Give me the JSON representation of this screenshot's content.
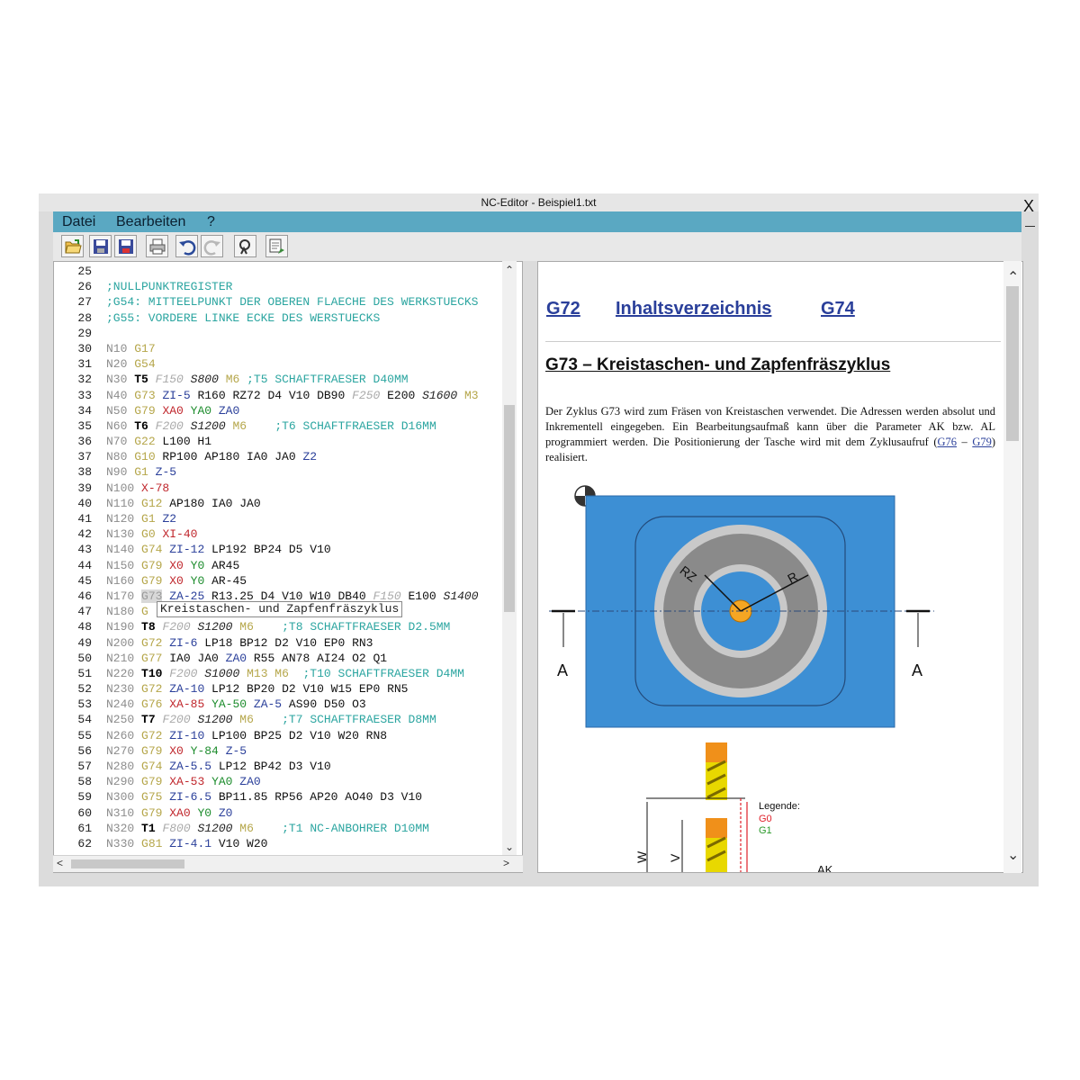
{
  "window": {
    "title": "NC-Editor  -  Beispiel1.txt",
    "close_glyph": "X"
  },
  "menu": {
    "items": [
      {
        "label": "Datei"
      },
      {
        "label": "Bearbeiten"
      },
      {
        "label": "?"
      }
    ]
  },
  "toolbar": {
    "buttons": [
      "open-icon",
      "save-icon",
      "save-as-icon",
      "print-icon",
      "undo-icon",
      "redo-icon",
      "search-icon",
      "simulation-icon"
    ]
  },
  "editor": {
    "lines": [
      {
        "n": "25",
        "t": []
      },
      {
        "n": "26",
        "t": [
          [
            ";NULLPUNKTREGISTER",
            "c"
          ]
        ]
      },
      {
        "n": "27",
        "t": [
          [
            ";G54: MITTEELPUNKT DER OBEREN FLAECHE DES WERKSTUECKS",
            "c"
          ]
        ]
      },
      {
        "n": "28",
        "t": [
          [
            ";G55: VORDERE LINKE ECKE DES WERSTUECKS",
            "c"
          ]
        ]
      },
      {
        "n": "29",
        "t": []
      },
      {
        "n": "30",
        "t": [
          [
            "N10 ",
            "n"
          ],
          [
            "G17",
            "g"
          ]
        ]
      },
      {
        "n": "31",
        "t": [
          [
            "N20 ",
            "n"
          ],
          [
            "G54",
            "g"
          ]
        ]
      },
      {
        "n": "32",
        "t": [
          [
            "N30 ",
            "n"
          ],
          [
            "T5",
            "t"
          ],
          [
            " ",
            "p"
          ],
          [
            "F150",
            "f"
          ],
          [
            " ",
            "p"
          ],
          [
            "S800",
            "s"
          ],
          [
            " ",
            "p"
          ],
          [
            "M6",
            "g"
          ],
          [
            " ;T5 SCHAFTFRAESER D40MM",
            "c"
          ]
        ]
      },
      {
        "n": "33",
        "t": [
          [
            "N40 ",
            "n"
          ],
          [
            "G73",
            "g"
          ],
          [
            " ",
            "p"
          ],
          [
            "ZI-5",
            "z"
          ],
          [
            " R160 RZ72 D4 V10 DB90 ",
            "p"
          ],
          [
            "F250",
            "f"
          ],
          [
            " E200 ",
            "p"
          ],
          [
            "S1600",
            "s"
          ],
          [
            " M3",
            "g"
          ]
        ]
      },
      {
        "n": "34",
        "t": [
          [
            "N50 ",
            "n"
          ],
          [
            "G79",
            "g"
          ],
          [
            " ",
            "p"
          ],
          [
            "XA0",
            "x"
          ],
          [
            " ",
            "p"
          ],
          [
            "YA0",
            "y"
          ],
          [
            " ",
            "p"
          ],
          [
            "ZA0",
            "z"
          ]
        ]
      },
      {
        "n": "35",
        "t": [
          [
            "N60 ",
            "n"
          ],
          [
            "T6",
            "t"
          ],
          [
            " ",
            "p"
          ],
          [
            "F200",
            "f"
          ],
          [
            " ",
            "p"
          ],
          [
            "S1200",
            "s"
          ],
          [
            " ",
            "p"
          ],
          [
            "M6",
            "g"
          ],
          [
            "    ;T6 SCHAFTFRAESER D16MM",
            "c"
          ]
        ]
      },
      {
        "n": "36",
        "t": [
          [
            "N70 ",
            "n"
          ],
          [
            "G22",
            "g"
          ],
          [
            " L100 H1",
            "p"
          ]
        ]
      },
      {
        "n": "37",
        "t": [
          [
            "N80 ",
            "n"
          ],
          [
            "G10",
            "g"
          ],
          [
            " RP100 AP180 IA0 JA0 ",
            "p"
          ],
          [
            "Z2",
            "z"
          ]
        ]
      },
      {
        "n": "38",
        "t": [
          [
            "N90 ",
            "n"
          ],
          [
            "G1",
            "g"
          ],
          [
            " ",
            "p"
          ],
          [
            "Z-5",
            "z"
          ]
        ]
      },
      {
        "n": "39",
        "t": [
          [
            "N100 ",
            "n"
          ],
          [
            "X-78",
            "x"
          ]
        ]
      },
      {
        "n": "40",
        "t": [
          [
            "N110 ",
            "n"
          ],
          [
            "G12",
            "g"
          ],
          [
            " AP180 IA0 JA0",
            "p"
          ]
        ]
      },
      {
        "n": "41",
        "t": [
          [
            "N120 ",
            "n"
          ],
          [
            "G1",
            "g"
          ],
          [
            " ",
            "p"
          ],
          [
            "Z2",
            "z"
          ]
        ]
      },
      {
        "n": "42",
        "t": [
          [
            "N130 ",
            "n"
          ],
          [
            "G0",
            "g"
          ],
          [
            " ",
            "p"
          ],
          [
            "XI-40",
            "x"
          ]
        ]
      },
      {
        "n": "43",
        "t": [
          [
            "N140 ",
            "n"
          ],
          [
            "G74",
            "g"
          ],
          [
            " ",
            "p"
          ],
          [
            "ZI-12",
            "z"
          ],
          [
            " LP192 BP24 D5 V10",
            "p"
          ]
        ]
      },
      {
        "n": "44",
        "t": [
          [
            "N150 ",
            "n"
          ],
          [
            "G79",
            "g"
          ],
          [
            " ",
            "p"
          ],
          [
            "X0",
            "x"
          ],
          [
            " ",
            "p"
          ],
          [
            "Y0",
            "y"
          ],
          [
            " AR45",
            "p"
          ]
        ]
      },
      {
        "n": "45",
        "t": [
          [
            "N160 ",
            "n"
          ],
          [
            "G79",
            "g"
          ],
          [
            " ",
            "p"
          ],
          [
            "X0",
            "x"
          ],
          [
            " ",
            "p"
          ],
          [
            "Y0",
            "y"
          ],
          [
            " AR-45",
            "p"
          ]
        ]
      },
      {
        "n": "46",
        "t": [
          [
            "N170 ",
            "n"
          ],
          [
            "G73",
            "sel"
          ],
          [
            " ",
            "p"
          ],
          [
            "ZA-25",
            "z"
          ],
          [
            " R13.25 D4 V10 W10 DB40 ",
            "p"
          ],
          [
            "F150",
            "f"
          ],
          [
            " E100 ",
            "p"
          ],
          [
            "S1400",
            "s"
          ]
        ]
      },
      {
        "n": "47",
        "t": [
          [
            "N180 ",
            "n"
          ],
          [
            "G",
            "g"
          ]
        ]
      },
      {
        "n": "48",
        "t": [
          [
            "N190 ",
            "n"
          ],
          [
            "T8",
            "t"
          ],
          [
            " ",
            "p"
          ],
          [
            "F200",
            "f"
          ],
          [
            " ",
            "p"
          ],
          [
            "S1200",
            "s"
          ],
          [
            " ",
            "p"
          ],
          [
            "M6",
            "g"
          ],
          [
            "    ;T8 SCHAFTFRAESER D2.5MM",
            "c"
          ]
        ]
      },
      {
        "n": "49",
        "t": [
          [
            "N200 ",
            "n"
          ],
          [
            "G72",
            "g"
          ],
          [
            " ",
            "p"
          ],
          [
            "ZI-6",
            "z"
          ],
          [
            " LP18 BP12 D2 V10 EP0 RN3",
            "p"
          ]
        ]
      },
      {
        "n": "50",
        "t": [
          [
            "N210 ",
            "n"
          ],
          [
            "G77",
            "g"
          ],
          [
            " IA0 JA0 ",
            "p"
          ],
          [
            "ZA0",
            "z"
          ],
          [
            " R55 AN78 AI24 O2 Q1",
            "p"
          ]
        ]
      },
      {
        "n": "51",
        "t": [
          [
            "N220 ",
            "n"
          ],
          [
            "T10",
            "t"
          ],
          [
            " ",
            "p"
          ],
          [
            "F200",
            "f"
          ],
          [
            " ",
            "p"
          ],
          [
            "S1000",
            "s"
          ],
          [
            " ",
            "p"
          ],
          [
            "M13 M6",
            "g"
          ],
          [
            "  ;T10 SCHAFTFRAESER D4MM",
            "c"
          ]
        ]
      },
      {
        "n": "52",
        "t": [
          [
            "N230 ",
            "n"
          ],
          [
            "G72",
            "g"
          ],
          [
            " ",
            "p"
          ],
          [
            "ZA-10",
            "z"
          ],
          [
            " LP12 BP20 D2 V10 W15 EP0 RN5",
            "p"
          ]
        ]
      },
      {
        "n": "53",
        "t": [
          [
            "N240 ",
            "n"
          ],
          [
            "G76",
            "g"
          ],
          [
            " ",
            "p"
          ],
          [
            "XA-85",
            "x"
          ],
          [
            " ",
            "p"
          ],
          [
            "YA-50",
            "y"
          ],
          [
            " ",
            "p"
          ],
          [
            "ZA-5",
            "z"
          ],
          [
            " AS90 D50 O3",
            "p"
          ]
        ]
      },
      {
        "n": "54",
        "t": [
          [
            "N250 ",
            "n"
          ],
          [
            "T7",
            "t"
          ],
          [
            " ",
            "p"
          ],
          [
            "F200",
            "f"
          ],
          [
            " ",
            "p"
          ],
          [
            "S1200",
            "s"
          ],
          [
            " ",
            "p"
          ],
          [
            "M6",
            "g"
          ],
          [
            "    ;T7 SCHAFTFRAESER D8MM",
            "c"
          ]
        ]
      },
      {
        "n": "55",
        "t": [
          [
            "N260 ",
            "n"
          ],
          [
            "G72",
            "g"
          ],
          [
            " ",
            "p"
          ],
          [
            "ZI-10",
            "z"
          ],
          [
            " LP100 BP25 D2 V10 W20 RN8",
            "p"
          ]
        ]
      },
      {
        "n": "56",
        "t": [
          [
            "N270 ",
            "n"
          ],
          [
            "G79",
            "g"
          ],
          [
            " ",
            "p"
          ],
          [
            "X0",
            "x"
          ],
          [
            " ",
            "p"
          ],
          [
            "Y-84",
            "y"
          ],
          [
            " ",
            "p"
          ],
          [
            "Z-5",
            "z"
          ]
        ]
      },
      {
        "n": "57",
        "t": [
          [
            "N280 ",
            "n"
          ],
          [
            "G74",
            "g"
          ],
          [
            " ",
            "p"
          ],
          [
            "ZA-5.5",
            "z"
          ],
          [
            " LP12 BP42 D3 V10",
            "p"
          ]
        ]
      },
      {
        "n": "58",
        "t": [
          [
            "N290 ",
            "n"
          ],
          [
            "G79",
            "g"
          ],
          [
            " ",
            "p"
          ],
          [
            "XA-53",
            "x"
          ],
          [
            " ",
            "p"
          ],
          [
            "YA0",
            "y"
          ],
          [
            " ",
            "p"
          ],
          [
            "ZA0",
            "z"
          ]
        ]
      },
      {
        "n": "59",
        "t": [
          [
            "N300 ",
            "n"
          ],
          [
            "G75",
            "g"
          ],
          [
            " ",
            "p"
          ],
          [
            "ZI-6.5",
            "z"
          ],
          [
            " BP11.85 RP56 AP20 AO40 D3 V10",
            "p"
          ]
        ]
      },
      {
        "n": "60",
        "t": [
          [
            "N310 ",
            "n"
          ],
          [
            "G79",
            "g"
          ],
          [
            " ",
            "p"
          ],
          [
            "XA0",
            "x"
          ],
          [
            " ",
            "p"
          ],
          [
            "Y0",
            "y"
          ],
          [
            " ",
            "p"
          ],
          [
            "Z0",
            "z"
          ]
        ]
      },
      {
        "n": "61",
        "t": [
          [
            "N320 ",
            "n"
          ],
          [
            "T1",
            "t"
          ],
          [
            " ",
            "p"
          ],
          [
            "F800",
            "f"
          ],
          [
            " ",
            "p"
          ],
          [
            "S1200",
            "s"
          ],
          [
            " ",
            "p"
          ],
          [
            "M6",
            "g"
          ],
          [
            "    ;T1 NC-ANBOHRER D10MM",
            "c"
          ]
        ]
      },
      {
        "n": "62",
        "t": [
          [
            "N330 ",
            "n"
          ],
          [
            "G81",
            "g"
          ],
          [
            " ",
            "p"
          ],
          [
            "ZI-4.1",
            "z"
          ],
          [
            " V10 W20",
            "p"
          ]
        ]
      }
    ],
    "tooltip": "Kreistaschen- und Zapfenfräszyklus"
  },
  "help": {
    "prev_link": "G72",
    "toc_link": "Inhaltsverzeichnis",
    "next_link": "G74",
    "heading": "G73 – Kreistaschen- und Zapfenfräszyklus",
    "para_1": "Der Zyklus G73 wird zum Fräsen von Kreistaschen verwendet. Die Adressen werden absolut und Inkrementell eingegeben. Ein Bearbeitungsaufmaß kann über die Parameter AK bzw. AL programmiert werden. Die Positionierung der Tasche wird mit dem Zyklusaufruf (",
    "link_g76": "G76",
    "dash": " – ",
    "link_g79": "G79",
    "para_2": ") realisiert.",
    "diagram": {
      "label_rz": "RZ",
      "label_r": "R",
      "section_left": "A",
      "section_right": "A",
      "legend_title": "Legende:",
      "legend_g0": "G0",
      "legend_g1": "G1",
      "dim_w": "W",
      "dim_v": "V",
      "dim_ak": "AK"
    }
  },
  "colors": {
    "menubar": "#5aa8c2",
    "workpiece": "#3d8fd4",
    "ring_grey": "#8a8a8a",
    "center_orange": "#f5a623",
    "link_blue": "#2a3f9a",
    "g0_red": "#e0202a",
    "g1_green": "#2a9a2a"
  }
}
